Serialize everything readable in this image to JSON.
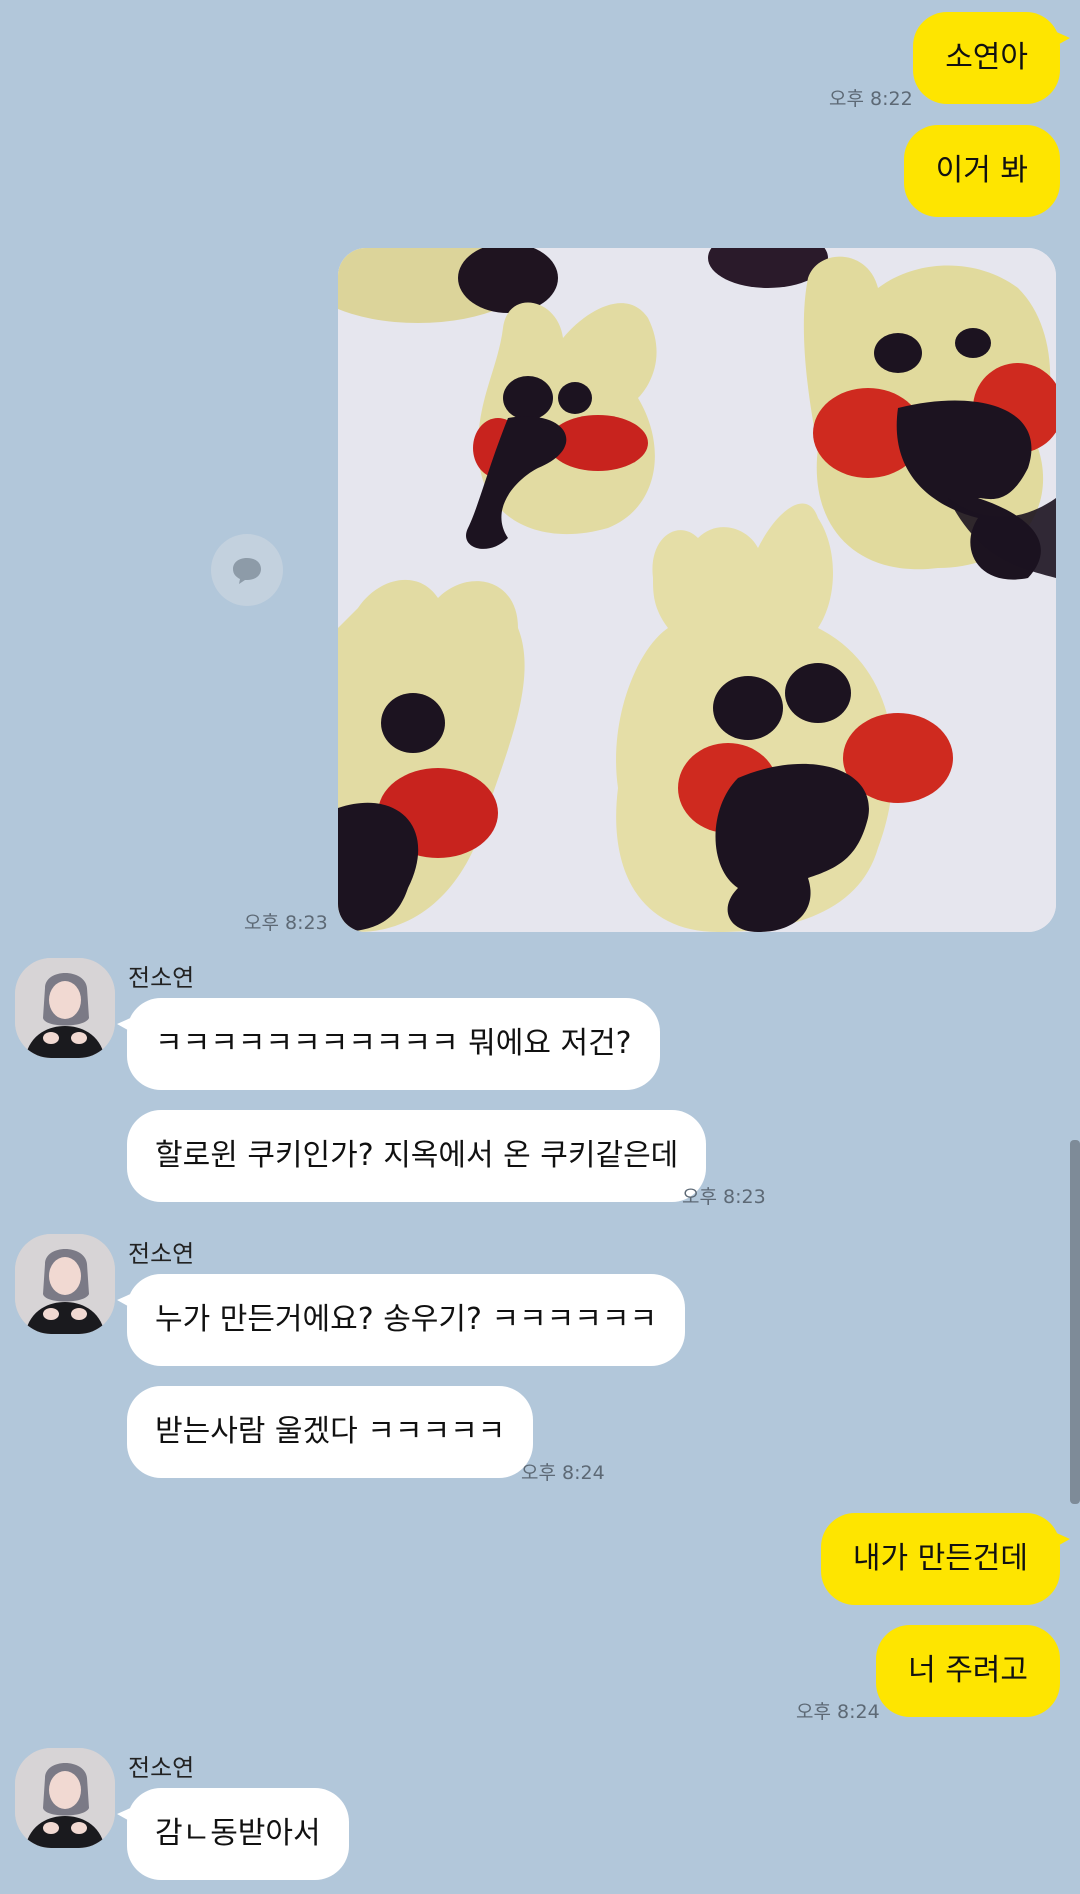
{
  "messages": {
    "me1": {
      "text": "소연아"
    },
    "me2": {
      "text": "이거 봐"
    },
    "me_time1": "오후 8:22",
    "photo_time": "오후 8:23",
    "you_name1": "전소연",
    "you1": {
      "text": "ㅋㅋㅋㅋㅋㅋㅋㅋㅋㅋㅋ 뭐에요 저건?"
    },
    "you2": {
      "text": "할로윈 쿠키인가? 지옥에서 온 쿠키같은데"
    },
    "you_time1": "오후 8:23",
    "you_name2": "전소연",
    "you3": {
      "text": "누가 만든거에요? 송우기? ㅋㅋㅋㅋㅋㅋ"
    },
    "you4": {
      "text": "받는사람 울겠다 ㅋㅋㅋㅋㅋ"
    },
    "you_time2": "오후 8:24",
    "me3": {
      "text": "내가 만든건데"
    },
    "me4": {
      "text": "너 주려고"
    },
    "me_time2": "오후 8:24",
    "you_name3": "전소연",
    "you5": {
      "text": "감ㄴ동받아서"
    }
  },
  "colors": {
    "background": "#b2c7da",
    "my_bubble": "#fee500",
    "their_bubble": "#ffffff"
  },
  "icons": {
    "share": "speech-bubble-icon"
  }
}
